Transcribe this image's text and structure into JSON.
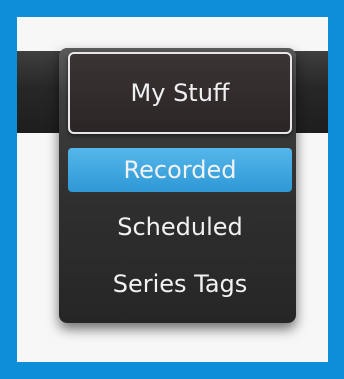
{
  "menu": {
    "title": "My Stuff",
    "items": [
      {
        "label": "Recorded",
        "selected": true
      },
      {
        "label": "Scheduled",
        "selected": false
      },
      {
        "label": "Series Tags",
        "selected": false
      }
    ]
  },
  "colors": {
    "outer_border": "#0f8ed8",
    "selected_item": "#2e98d6",
    "panel_background": "#2f2f2f",
    "text": "#f0f0f0"
  }
}
